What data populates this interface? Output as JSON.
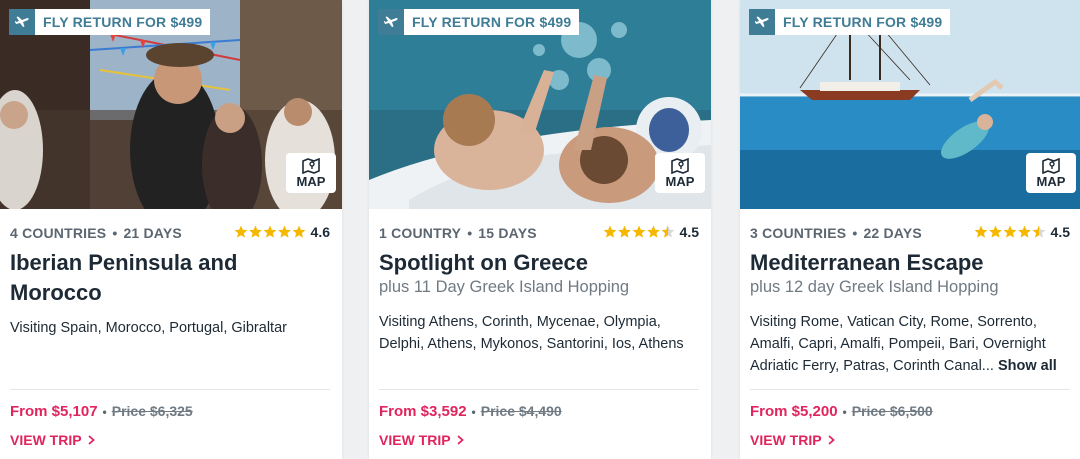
{
  "colors": {
    "accent": "#e0245e",
    "badge": "#3f7c95",
    "star": "#f5b800"
  },
  "cards": [
    {
      "badge": "FLY RETURN FOR $499",
      "map": "MAP",
      "countries": "4 COUNTRIES",
      "days": "21 DAYS",
      "rating": "4.6",
      "title": "Iberian Peninsula and Morocco",
      "subtitle": "",
      "description": "Visiting Spain, Morocco, Portugal, Gibraltar",
      "show_all": "",
      "price_from": "From $5,107",
      "price_old": "Price $6,325",
      "cta": "VIEW TRIP"
    },
    {
      "badge": "FLY RETURN FOR $499",
      "map": "MAP",
      "countries": "1 COUNTRY",
      "days": "15 DAYS",
      "rating": "4.5",
      "title": "Spotlight on Greece",
      "subtitle": "plus 11 Day Greek Island Hopping",
      "description": "Visiting Athens, Corinth, Mycenae, Olympia, Delphi, Athens, Mykonos, Santorini, Ios, Athens",
      "show_all": "",
      "price_from": "From $3,592",
      "price_old": "Price $4,490",
      "cta": "VIEW TRIP"
    },
    {
      "badge": "FLY RETURN FOR $499",
      "map": "MAP",
      "countries": "3 COUNTRIES",
      "days": "22 DAYS",
      "rating": "4.5",
      "title": "Mediterranean Escape",
      "subtitle": "plus 12 day Greek Island Hopping",
      "description": "Visiting Rome, Vatican City, Rome, Sorrento, Amalfi, Capri, Amalfi, Pompeii, Bari, Overnight Adriatic Ferry, Patras, Corinth Canal...",
      "show_all": "Show all",
      "price_from": "From $5,200",
      "price_old": "Price $6,500",
      "cta": "VIEW TRIP"
    }
  ]
}
